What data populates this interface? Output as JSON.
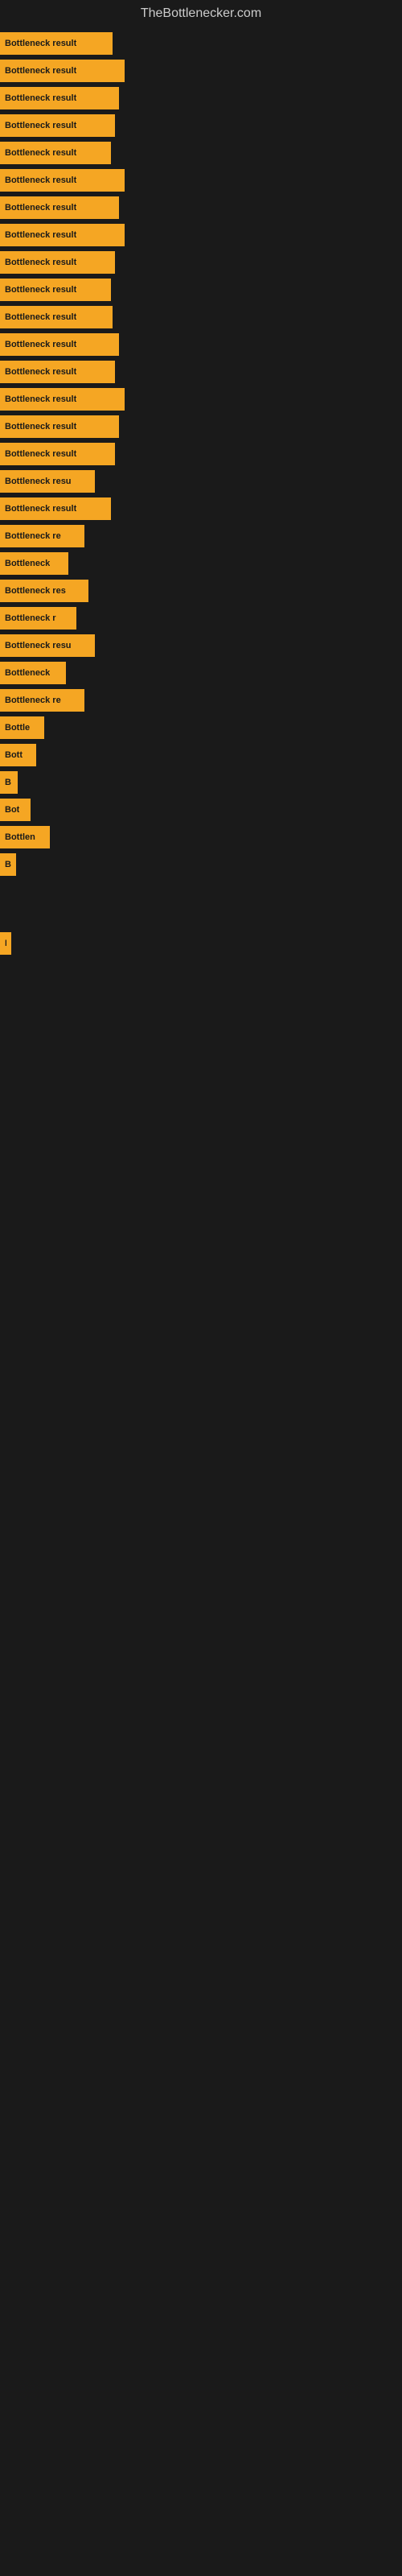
{
  "site": {
    "title": "TheBottlenecker.com"
  },
  "bars": [
    {
      "label": "Bottleneck result",
      "width": 140,
      "visible_label": "Bottleneck result"
    },
    {
      "label": "Bottleneck result",
      "width": 155,
      "visible_label": "Bottleneck result"
    },
    {
      "label": "Bottleneck result",
      "width": 148,
      "visible_label": "Bottleneck result"
    },
    {
      "label": "Bottleneck result",
      "width": 143,
      "visible_label": "Bottleneck result"
    },
    {
      "label": "Bottleneck result",
      "width": 138,
      "visible_label": "Bottleneck result"
    },
    {
      "label": "Bottleneck result",
      "width": 155,
      "visible_label": "Bottleneck result"
    },
    {
      "label": "Bottleneck result",
      "width": 148,
      "visible_label": "Bottleneck result"
    },
    {
      "label": "Bottleneck result",
      "width": 155,
      "visible_label": "Bottleneck result"
    },
    {
      "label": "Bottleneck result",
      "width": 143,
      "visible_label": "Bottleneck result"
    },
    {
      "label": "Bottleneck result",
      "width": 138,
      "visible_label": "Bottleneck result"
    },
    {
      "label": "Bottleneck result",
      "width": 140,
      "visible_label": "Bottleneck result"
    },
    {
      "label": "Bottleneck result",
      "width": 148,
      "visible_label": "Bottleneck result"
    },
    {
      "label": "Bottleneck result",
      "width": 143,
      "visible_label": "Bottleneck result"
    },
    {
      "label": "Bottleneck result",
      "width": 155,
      "visible_label": "Bottleneck result"
    },
    {
      "label": "Bottleneck result",
      "width": 148,
      "visible_label": "Bottleneck result"
    },
    {
      "label": "Bottleneck result",
      "width": 143,
      "visible_label": "Bottleneck result"
    },
    {
      "label": "Bottleneck resu",
      "width": 118,
      "visible_label": "Bottleneck resu"
    },
    {
      "label": "Bottleneck result",
      "width": 138,
      "visible_label": "Bottleneck result"
    },
    {
      "label": "Bottleneck re",
      "width": 105,
      "visible_label": "Bottleneck re"
    },
    {
      "label": "Bottleneck",
      "width": 85,
      "visible_label": "Bottleneck"
    },
    {
      "label": "Bottleneck res",
      "width": 110,
      "visible_label": "Bottleneck res"
    },
    {
      "label": "Bottleneck r",
      "width": 95,
      "visible_label": "Bottleneck r"
    },
    {
      "label": "Bottleneck resu",
      "width": 118,
      "visible_label": "Bottleneck resu"
    },
    {
      "label": "Bottleneck",
      "width": 82,
      "visible_label": "Bottleneck"
    },
    {
      "label": "Bottleneck re",
      "width": 105,
      "visible_label": "Bottleneck re"
    },
    {
      "label": "Bottle",
      "width": 55,
      "visible_label": "Bottle"
    },
    {
      "label": "Bott",
      "width": 45,
      "visible_label": "Bott"
    },
    {
      "label": "B",
      "width": 22,
      "visible_label": "B"
    },
    {
      "label": "Bot",
      "width": 38,
      "visible_label": "Bot"
    },
    {
      "label": "Bottlen",
      "width": 62,
      "visible_label": "Bottlen"
    },
    {
      "label": "B",
      "width": 20,
      "visible_label": "B"
    },
    {
      "label": "",
      "width": 0,
      "visible_label": ""
    },
    {
      "label": "",
      "width": 0,
      "visible_label": ""
    },
    {
      "label": "B",
      "width": 14,
      "visible_label": "B"
    },
    {
      "label": "",
      "width": 0,
      "visible_label": ""
    },
    {
      "label": "",
      "width": 0,
      "visible_label": ""
    },
    {
      "label": "",
      "width": 0,
      "visible_label": ""
    },
    {
      "label": "",
      "width": 0,
      "visible_label": ""
    },
    {
      "label": "",
      "width": 0,
      "visible_label": ""
    },
    {
      "label": "",
      "width": 0,
      "visible_label": ""
    }
  ]
}
